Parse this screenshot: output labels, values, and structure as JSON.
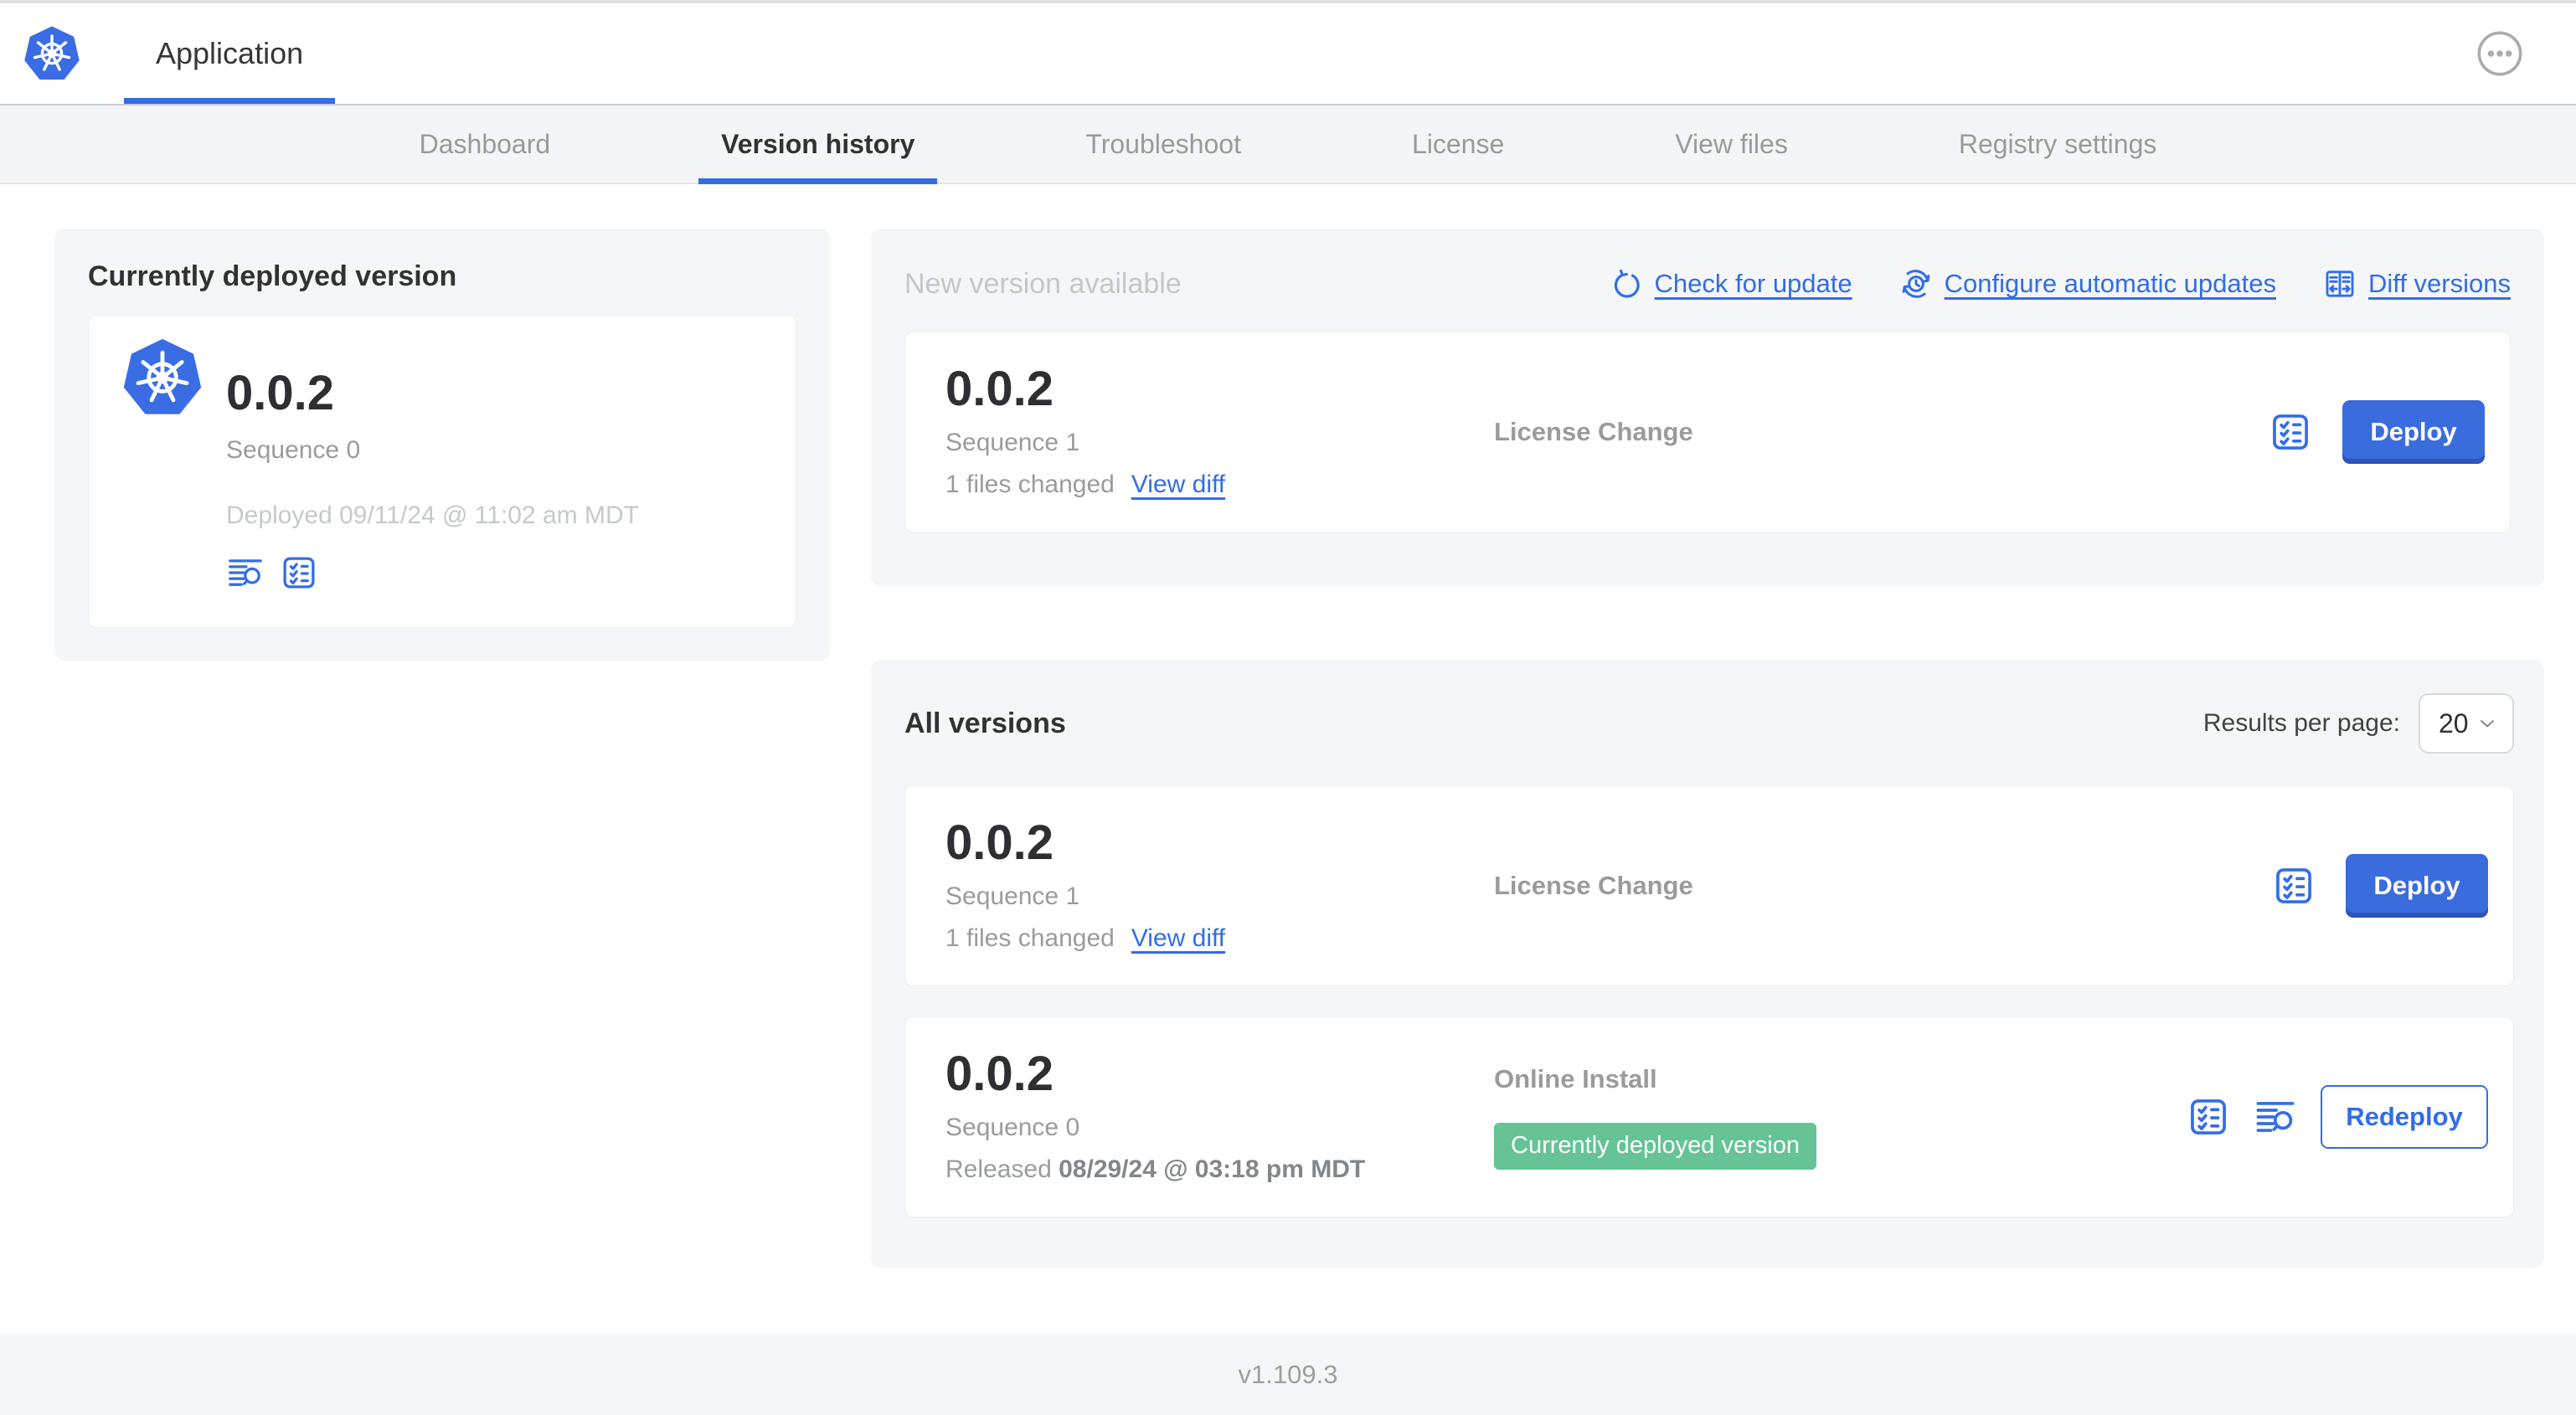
{
  "app": {
    "title": "Application",
    "footer_version": "v1.109.3"
  },
  "nav": {
    "tabs": [
      {
        "label": "Dashboard",
        "active": false
      },
      {
        "label": "Version history",
        "active": true
      },
      {
        "label": "Troubleshoot",
        "active": false
      },
      {
        "label": "License",
        "active": false
      },
      {
        "label": "View files",
        "active": false
      },
      {
        "label": "Registry settings",
        "active": false
      }
    ]
  },
  "current_version_panel": {
    "title": "Currently deployed version",
    "version": "0.0.2",
    "sequence": "Sequence 0",
    "deployed_timestamp": "Deployed 09/11/24 @ 11:02 am MDT"
  },
  "new_version_panel": {
    "title": "New version available",
    "check_for_update_label": "Check for update",
    "configure_updates_label": "Configure automatic updates",
    "diff_versions_label": "Diff versions",
    "card": {
      "version": "0.0.2",
      "sequence": "Sequence 1",
      "files_changed": "1 files changed",
      "view_diff_label": "View diff",
      "source": "License Change",
      "deploy_label": "Deploy"
    }
  },
  "all_versions_panel": {
    "title": "All versions",
    "results_per_page_label": "Results per page:",
    "results_per_page_value": "20",
    "rows": [
      {
        "version": "0.0.2",
        "sequence": "Sequence 1",
        "files_changed": "1 files changed",
        "view_diff_label": "View diff",
        "source": "License Change",
        "action_label": "Deploy"
      },
      {
        "version": "0.0.2",
        "sequence": "Sequence 0",
        "released_prefix": "Released",
        "released_timestamp": "08/29/24 @ 03:18 pm MDT",
        "source": "Online Install",
        "badge_label": "Currently deployed version",
        "action_label": "Redeploy"
      }
    ]
  },
  "icons": {
    "app_logo": "kubernetes-logo",
    "header_menu": "ellipsis-circle-icon",
    "check_for_update": "refresh-icon",
    "configure_updates": "schedule-update-icon",
    "diff_versions": "diff-icon",
    "view_logs": "logs-search-icon",
    "preflight_checks": "checklist-icon",
    "select_chevron": "chevron-down-icon"
  },
  "colors": {
    "accent_blue": "#326de6",
    "button_blue": "#3b6cde",
    "badge_green": "#65c396",
    "panel_gray": "#f4f6f8",
    "text_dark": "#323232",
    "text_muted": "#9b9b9b",
    "text_light": "#c6c9cc"
  }
}
